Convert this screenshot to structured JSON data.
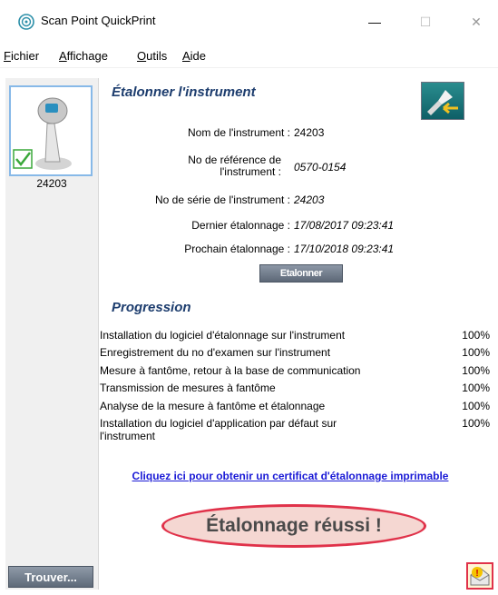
{
  "window": {
    "title": "Scan Point QuickPrint",
    "minimize_glyph": "—",
    "maximize_glyph": "☐",
    "close_glyph": "✕"
  },
  "menu": {
    "fichier_u": "F",
    "fichier_rest": "ichier",
    "affichage_u": "A",
    "affichage_rest": "ffichage",
    "outils_u": "O",
    "outils_rest": "utils",
    "aide_u": "A",
    "aide_rest": "ide"
  },
  "sidebar": {
    "device_label": "24203",
    "find_button": "Trouver..."
  },
  "calibrate": {
    "title": "Étalonner l'instrument",
    "name_label": "Nom de l'instrument :",
    "name_value": "24203",
    "ref_label_1": "No de référence de",
    "ref_label_2": "l'instrument :",
    "ref_value": "0570-0154",
    "serial_label": "No de série de l'instrument :",
    "serial_value": "24203",
    "last_label": "Dernier étalonnage :",
    "last_value": "17/08/2017 09:23:41",
    "next_label": "Prochain étalonnage :",
    "next_value": "17/10/2018 09:23:41",
    "button": "Etalonner"
  },
  "progress": {
    "title": "Progression",
    "steps": [
      {
        "label": "Installation du logiciel d'étalonnage sur l'instrument",
        "pct": "100%"
      },
      {
        "label": "Enregistrement du no d'examen sur l'instrument",
        "pct": "100%"
      },
      {
        "label": "Mesure à fantôme, retour à la base de communication",
        "pct": "100%"
      },
      {
        "label": "Transmission de mesures à fantôme",
        "pct": "100%"
      },
      {
        "label": "Analyse de la mesure à fantôme et étalonnage",
        "pct": "100%"
      },
      {
        "label": "Installation du logiciel d'application par défaut sur l'instrument",
        "pct": "100%"
      }
    ]
  },
  "certificate_link": "Cliquez ici pour obtenir un certificat d'étalonnage imprimable",
  "success_message": "Étalonnage réussi !",
  "colors": {
    "title_blue": "#1d3d6e",
    "link_blue": "#1a1ad6",
    "success_border": "#e0324a",
    "success_fill": "#f5d7d2",
    "check_green": "#3aa83a"
  }
}
